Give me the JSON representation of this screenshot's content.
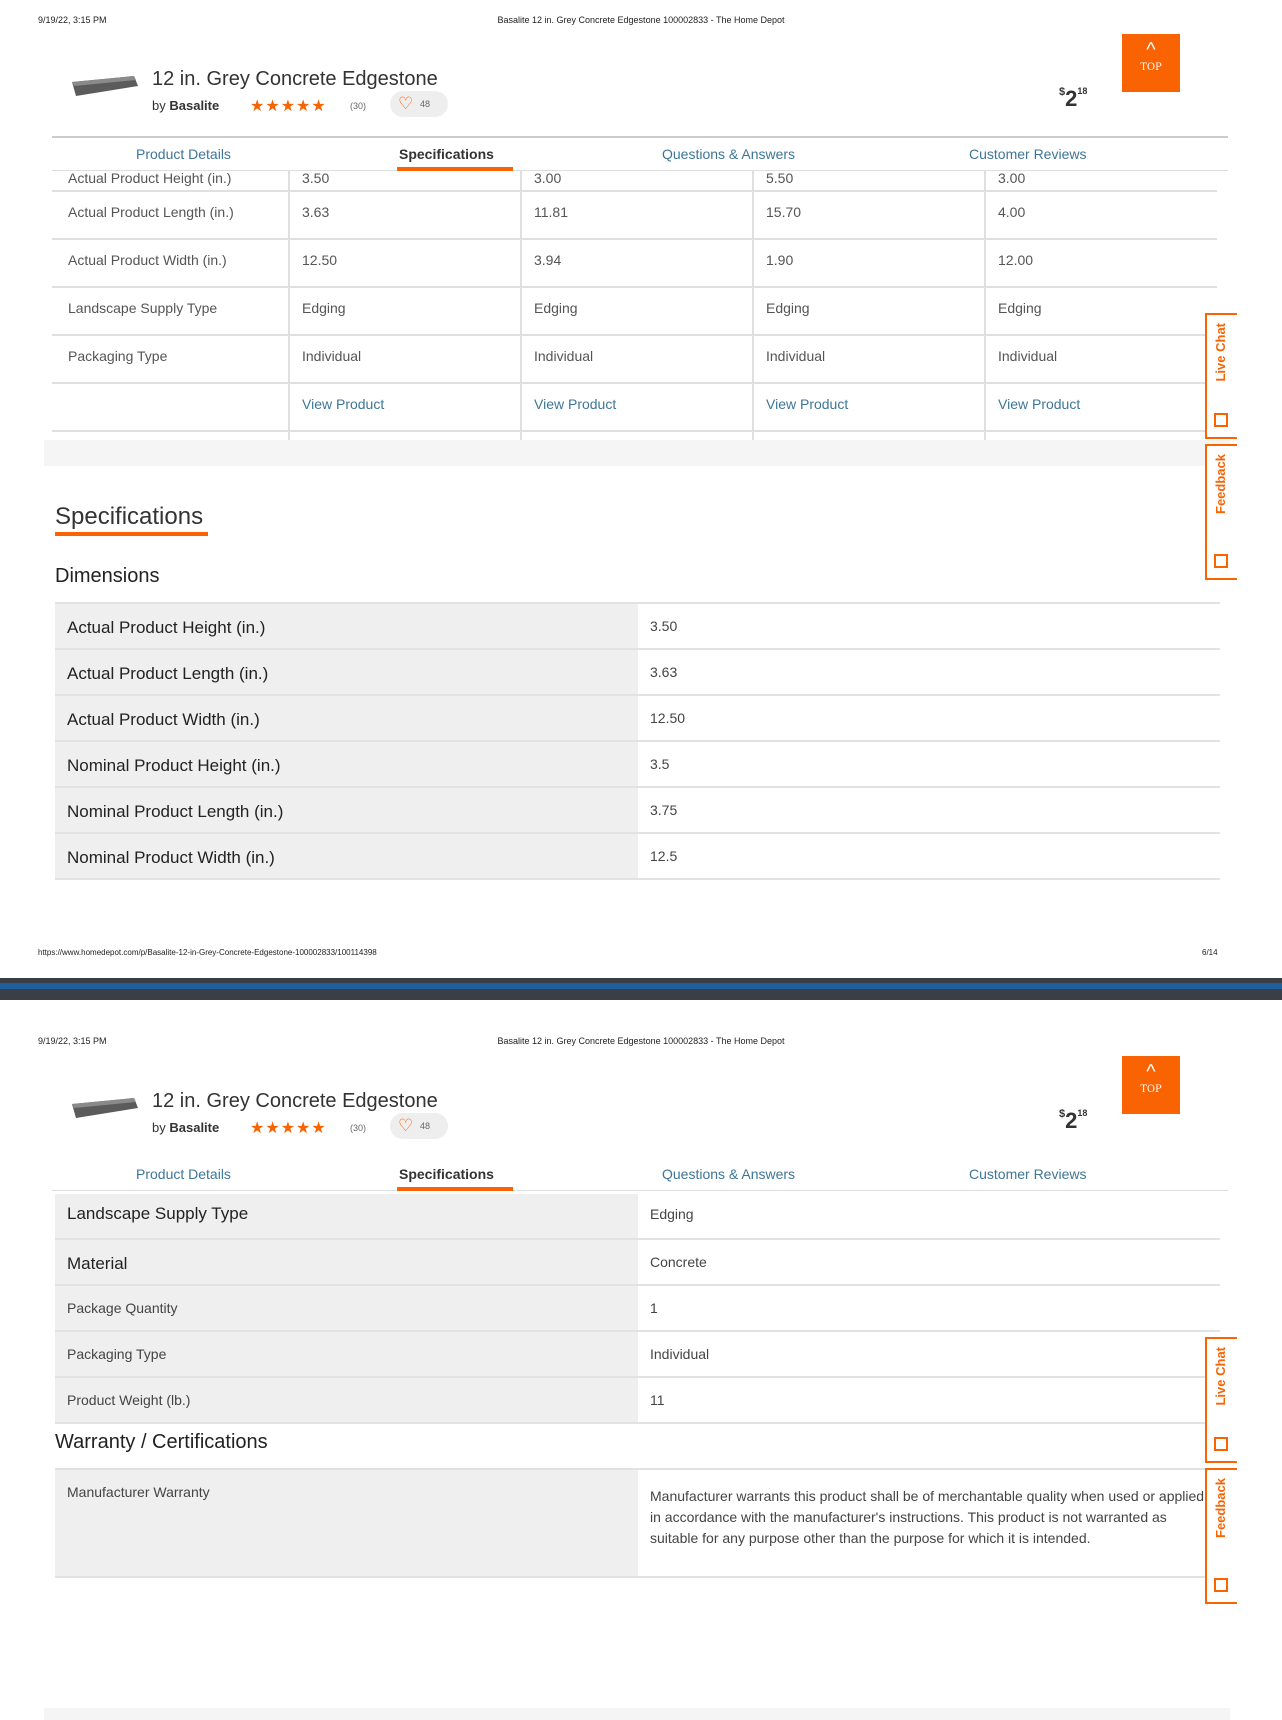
{
  "print_header": {
    "date": "9/19/22, 3:15 PM",
    "title": "Basalite 12 in. Grey Concrete Edgestone 100002833 - The Home Depot"
  },
  "product": {
    "name": "12 in. Grey Concrete Edgestone",
    "by_prefix": "by",
    "brand": "Basalite",
    "stars": "★★★★★",
    "rating_count": "(30)",
    "favorites_count": "48",
    "price_currency": "$",
    "price_dollars": "2",
    "price_cents": "18"
  },
  "top_button": {
    "label": "TOP"
  },
  "tabs": [
    {
      "label": "Product Details"
    },
    {
      "label": "Specifications"
    },
    {
      "label": "Questions & Answers"
    },
    {
      "label": "Customer Reviews"
    }
  ],
  "compare_table": {
    "rows": [
      {
        "label": "Actual Product Height (in.)",
        "values": [
          "3.50",
          "3.00",
          "5.50",
          "3.00"
        ]
      },
      {
        "label": "Actual Product Length (in.)",
        "values": [
          "3.63",
          "11.81",
          "15.70",
          "4.00"
        ]
      },
      {
        "label": "Actual Product Width (in.)",
        "values": [
          "12.50",
          "3.94",
          "1.90",
          "12.00"
        ]
      },
      {
        "label": "Landscape Supply Type",
        "values": [
          "Edging",
          "Edging",
          "Edging",
          "Edging"
        ]
      },
      {
        "label": "Packaging Type",
        "values": [
          "Individual",
          "Individual",
          "Individual",
          "Individual"
        ]
      },
      {
        "label": "",
        "values": [
          "View Product",
          "View Product",
          "View Product",
          "View Product"
        ]
      }
    ]
  },
  "specifications": {
    "heading": "Specifications",
    "dimensions_title": "Dimensions",
    "dimensions": [
      {
        "key": "Actual Product Height (in.)",
        "value": "3.50"
      },
      {
        "key": "Actual Product Length (in.)",
        "value": "3.63"
      },
      {
        "key": "Actual Product Width (in.)",
        "value": "12.50"
      },
      {
        "key": "Nominal Product Height (in.)",
        "value": "3.5"
      },
      {
        "key": "Nominal Product Length (in.)",
        "value": "3.75"
      },
      {
        "key": "Nominal Product Width (in.)",
        "value": "12.5"
      }
    ],
    "details": [
      {
        "key": "Landscape Supply Type",
        "value": "Edging"
      },
      {
        "key": "Material",
        "value": "Concrete"
      },
      {
        "key": "Package Quantity",
        "value": "1"
      },
      {
        "key": "Packaging Type",
        "value": "Individual"
      },
      {
        "key": "Product Weight (lb.)",
        "value": "11"
      }
    ],
    "warranty_title": "Warranty / Certifications",
    "warranty": [
      {
        "key": "Manufacturer Warranty",
        "value": "Manufacturer warrants this product shall be of merchantable quality when used or applied in accordance with the manufacturer's instructions. This product is not warranted as suitable for any purpose other than the purpose for which it is intended."
      }
    ]
  },
  "side_tabs": {
    "live_chat": "Live Chat",
    "feedback": "Feedback"
  },
  "print_footer": {
    "url": "https://www.homedepot.com/p/Basalite-12-in-Grey-Concrete-Edgestone-100002833/100114398",
    "page": "6/14"
  },
  "colors": {
    "accent": "#f96302",
    "link": "#3e7697",
    "divider": "#3a3f47"
  }
}
